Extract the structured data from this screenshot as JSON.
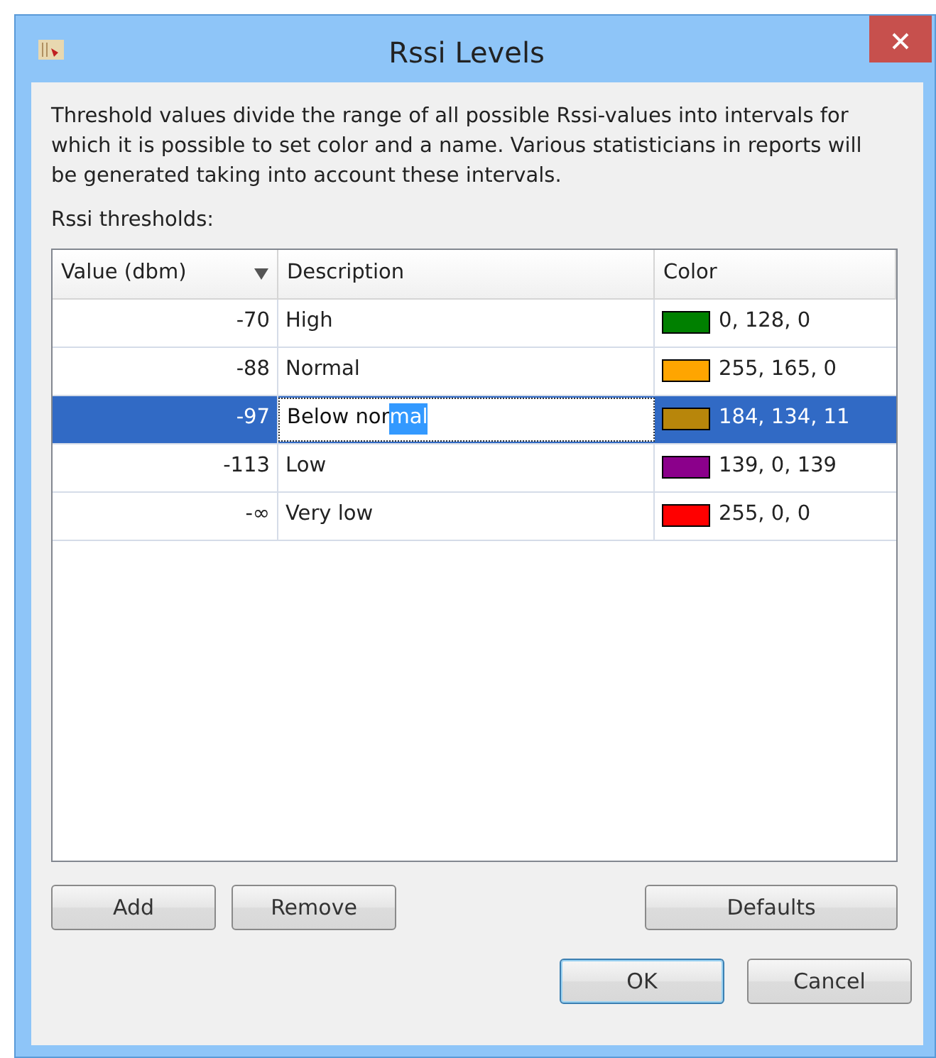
{
  "window": {
    "title": "Rssi Levels"
  },
  "intro": "Threshold values divide the range of all possible Rssi-values into intervals for which it is possible to set color and a name. Various statisticians in reports will be generated taking into account these intervals.",
  "table_label": "Rssi thresholds:",
  "table": {
    "columns": [
      {
        "label": "Value (dbm)",
        "sorted": true
      },
      {
        "label": "Description",
        "sorted": false
      },
      {
        "label": "Color",
        "sorted": false
      }
    ],
    "rows": [
      {
        "value": "-70",
        "description": "High",
        "color": "#008000",
        "color_text": "0, 128, 0",
        "selected": false
      },
      {
        "value": "-88",
        "description": "Normal",
        "color": "#ffa500",
        "color_text": "255, 165, 0",
        "selected": false
      },
      {
        "value": "-97",
        "description": "Below nor",
        "selected_text": "mal",
        "editing": true,
        "color": "#b8860b",
        "color_text": "184, 134, 11",
        "selected": true
      },
      {
        "value": "-113",
        "description": "Low",
        "color": "#8b008b",
        "color_text": "139, 0, 139",
        "selected": false
      },
      {
        "value": "-∞",
        "description": "Very low",
        "color": "#ff0000",
        "color_text": "255, 0, 0",
        "selected": false
      }
    ]
  },
  "table_buttons": [
    "Add",
    "Remove",
    "Defaults"
  ],
  "dialog_buttons": [
    {
      "label": "OK",
      "default": true
    },
    {
      "label": "Cancel",
      "default": false
    }
  ]
}
